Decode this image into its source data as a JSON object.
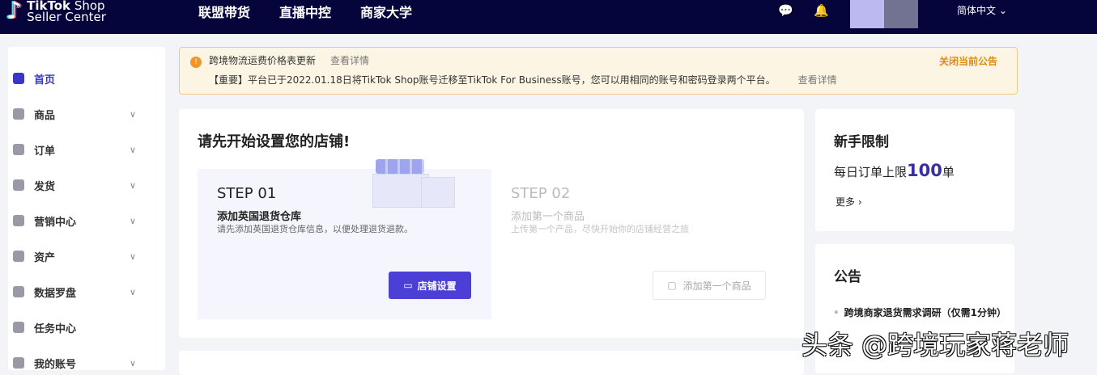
{
  "header": {
    "logo_line1_bold": "TikTok",
    "logo_line1": "Shop",
    "logo_line2": "Seller Center",
    "nav": [
      "联盟带货",
      "直播中控",
      "商家大学"
    ],
    "language": "简体中文"
  },
  "sidebar": {
    "items": [
      {
        "label": "首页"
      },
      {
        "label": "商品"
      },
      {
        "label": "订单"
      },
      {
        "label": "发货"
      },
      {
        "label": "营销中心"
      },
      {
        "label": "资产"
      },
      {
        "label": "数据罗盘"
      },
      {
        "label": "任务中心"
      },
      {
        "label": "我的账号"
      }
    ]
  },
  "notice": {
    "line1": "跨境物流运费价格表更新",
    "line2": "【重要】平台已于2022.01.18日将TikTok Shop账号迁移至TikTok For Business账号，您可以用相同的账号和密码登录两个平台。",
    "link": "查看详情",
    "close": "关闭当前公告"
  },
  "setup": {
    "title": "请先开始设置您的店铺!",
    "step1": {
      "label": "STEP 01",
      "title": "添加英国退货仓库",
      "desc": "请先添加英国退货仓库信息，以便处理退货退款。",
      "button": "店铺设置"
    },
    "step2": {
      "label": "STEP 02",
      "title": "添加第一个商品",
      "desc": "上传第一个产品，尽快开始你的店铺经营之旅",
      "button": "添加第一个商品"
    }
  },
  "limit": {
    "title": "新手限制",
    "prefix": "每日订单上限",
    "value": "100",
    "suffix": "单",
    "more": "更多"
  },
  "announce": {
    "title": "公告",
    "item": "跨境商家退货需求调研（仅需1分钟）"
  },
  "watermark": "头条 @跨境玩家蒋老师",
  "colors": {
    "nav_bg": "#05053c",
    "accent": "#4b3fd8",
    "warning": "#f0952a"
  }
}
